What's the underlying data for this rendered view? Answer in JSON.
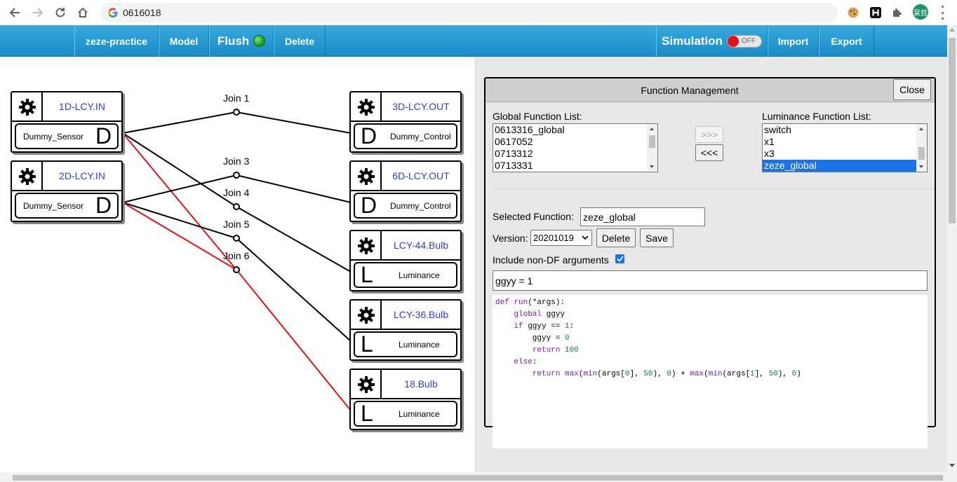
{
  "browser": {
    "url": "0616018",
    "avatar_text": "呆哲"
  },
  "appbar": {
    "project": "zeze-practice",
    "model": "Model",
    "flush": "Flush",
    "delete": "Delete",
    "simulation": "Simulation",
    "sim_toggle": "OFF",
    "import": "Import",
    "export": "Export"
  },
  "nodes": [
    {
      "title": "1D-LCY.IN",
      "func": "Dummy_Sensor",
      "letter": "D"
    },
    {
      "title": "2D-LCY.IN",
      "func": "Dummy_Sensor",
      "letter": "D"
    },
    {
      "title": "3D-LCY.OUT",
      "func": "Dummy_Control",
      "letter": "D"
    },
    {
      "title": "6D-LCY.OUT",
      "func": "Dummy_Control",
      "letter": "D"
    },
    {
      "title": "LCY-44.Bulb",
      "func": "Luminance",
      "letter": "L"
    },
    {
      "title": "LCY-36.Bulb",
      "func": "Luminance",
      "letter": "L"
    },
    {
      "title": "18.Bulb",
      "func": "Luminance",
      "letter": "L"
    }
  ],
  "joins": [
    "Join 1",
    "Join 3",
    "Join 4",
    "Join 5",
    "Join 6"
  ],
  "panel": {
    "title": "Function Management",
    "close": "Close",
    "global_list_label": "Global Function List:",
    "global_list": [
      "0613316_global",
      "0617052",
      "0713312",
      "0713331"
    ],
    "luminance_list_label": "Luminance Function List:",
    "luminance_list": [
      "switch",
      "x1",
      "x3",
      "zeze_global"
    ],
    "move_right": ">>>",
    "move_left": "<<<",
    "selected_label": "Selected Function:",
    "selected_value": "zeze_global",
    "version_label": "Version:",
    "version_value": "20201019",
    "delete": "Delete",
    "save": "Save",
    "include_label": "Include non-DF arguments",
    "include_checked": true,
    "args_text": "ggyy = 1",
    "code_lines": [
      "def run(*args):",
      "    global ggyy",
      "    if ggyy == 1:",
      "        ggyy = 0",
      "        return 100",
      "    else:",
      "        return max(min(args[0], 50), 0) + max(min(args[1], 50), 0)"
    ]
  },
  "colors": {
    "header": "#1b8cc8",
    "node_title": "#2f3ed6",
    "link_red": "#e8101a",
    "selection": "#1a73e8"
  }
}
